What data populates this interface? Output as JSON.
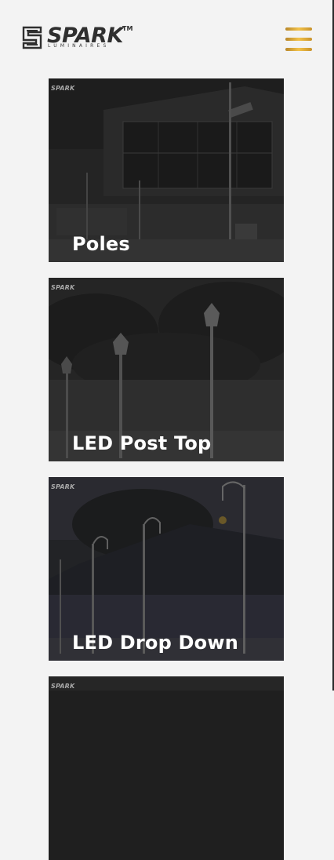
{
  "brand": {
    "name": "SPARK",
    "trademark": "TM",
    "tagline": "LUMINAIRES",
    "accent_color": "#e0ac37"
  },
  "header": {
    "menu_icon": "hamburger-menu-icon"
  },
  "cards": [
    {
      "badge": "SPARK",
      "title": "Poles"
    },
    {
      "badge": "SPARK",
      "title": "LED Post Top"
    },
    {
      "badge": "SPARK",
      "title": "LED Drop Down"
    },
    {
      "badge": "SPARK",
      "title": ""
    }
  ]
}
